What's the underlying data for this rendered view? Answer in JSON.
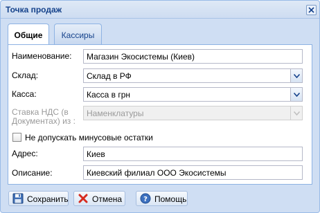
{
  "window": {
    "title": "Точка продаж"
  },
  "tabs": [
    {
      "label": "Общие",
      "active": true
    },
    {
      "label": "Кассиры",
      "active": false
    }
  ],
  "form": {
    "name_label": "Наименование:",
    "name_value": "Магазин Экосистемы (Киев)",
    "warehouse_label": "Склад:",
    "warehouse_value": "Склад в РФ",
    "cashbox_label": "Касса:",
    "cashbox_value": "Касса в грн",
    "vat_label_line1": "Ставка НДС (в",
    "vat_label_line2": "Документах) из :",
    "vat_value": "Наменклатуры",
    "negative_stock_label": "Не допускать минусовые остатки",
    "negative_stock_checked": false,
    "address_label": "Адрес:",
    "address_value": "Киев",
    "description_label": "Описание:",
    "description_value": "Киевский филиал ООО Экосистемы"
  },
  "buttons": {
    "save": "Сохранить",
    "cancel": "Отмена",
    "help": "Помощь"
  },
  "icons": {
    "close": "close-icon",
    "save": "floppy-disk-icon",
    "cancel": "red-x-icon",
    "help": "question-circle-icon",
    "dropdown": "chevron-down-icon"
  },
  "colors": {
    "title_text": "#15428b",
    "frame_bg": "#cfdef3",
    "border": "#99bbe8"
  }
}
